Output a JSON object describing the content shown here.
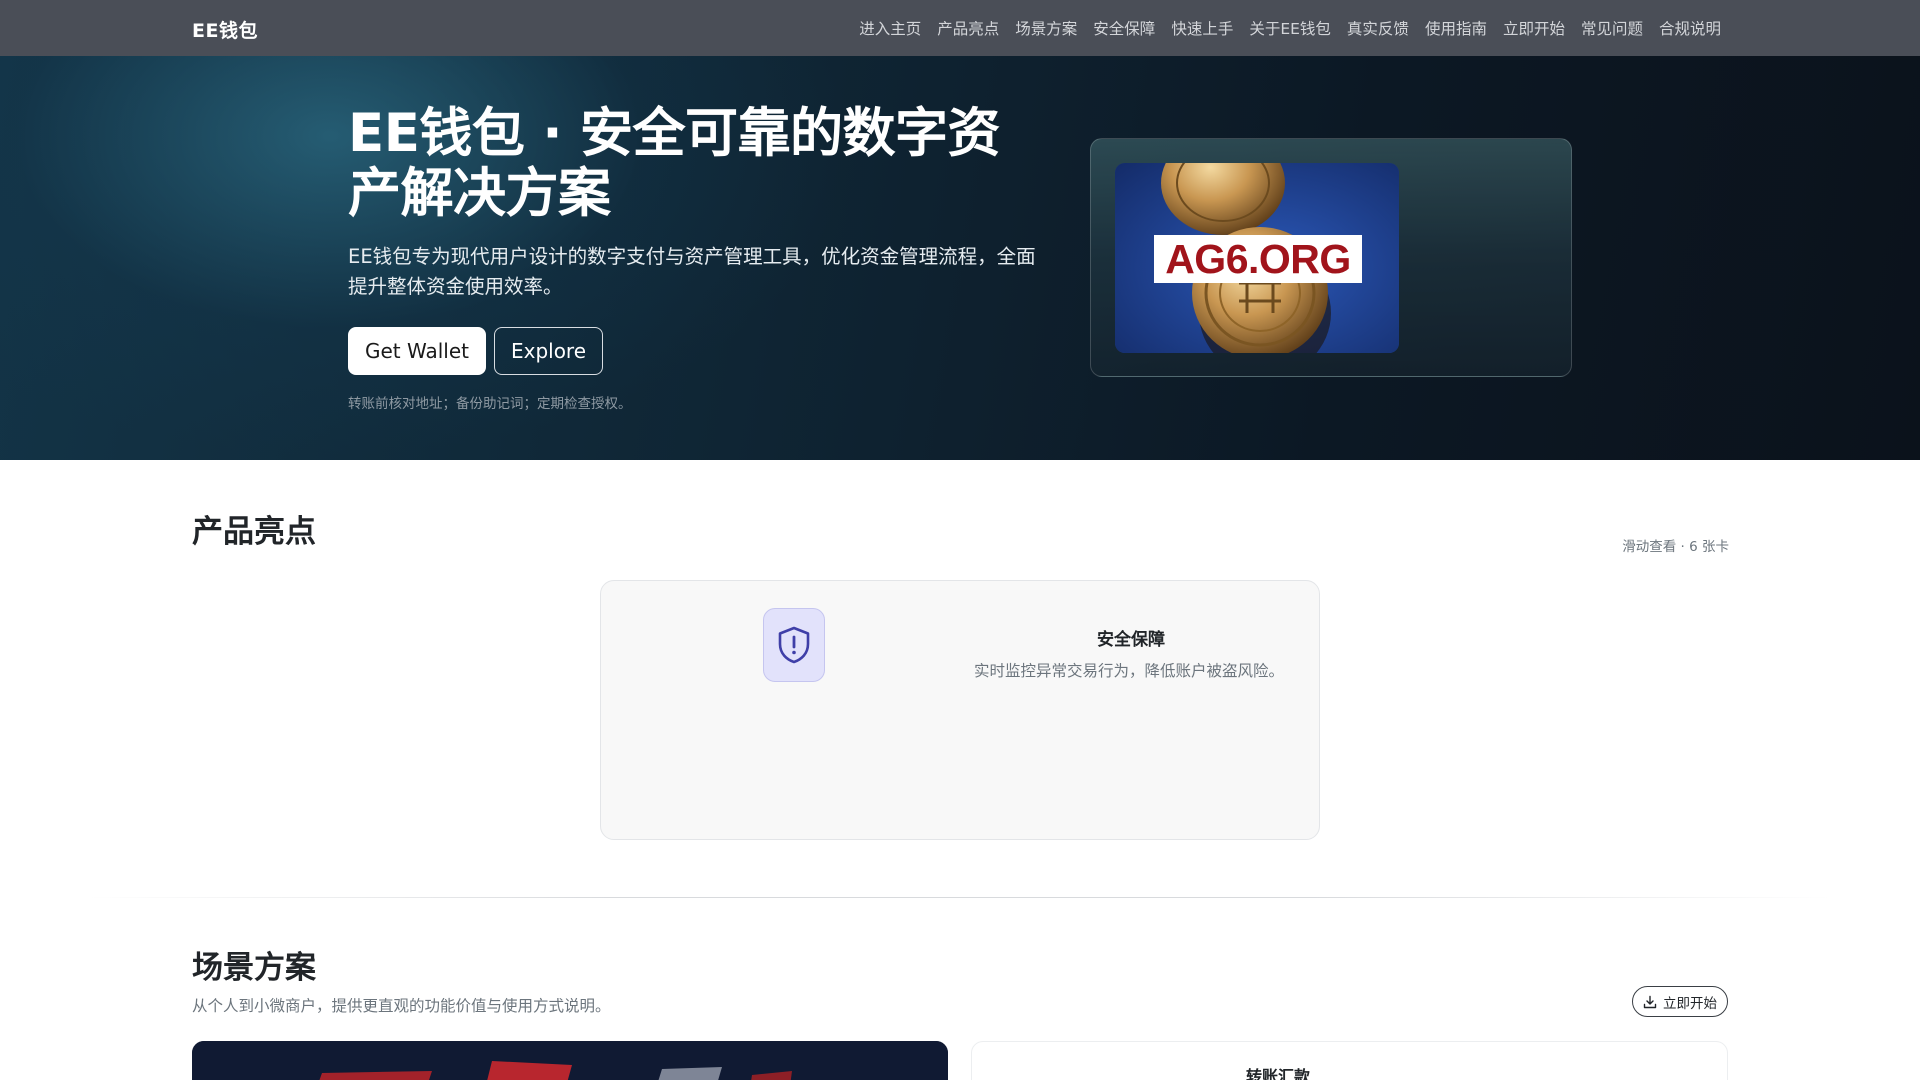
{
  "nav": {
    "brand": "EE钱包",
    "links": [
      "进入主页",
      "产品亮点",
      "场景方案",
      "安全保障",
      "快速上手",
      "关于EE钱包",
      "真实反馈",
      "使用指南",
      "立即开始",
      "常见问题",
      "合规说明"
    ]
  },
  "hero": {
    "title": "EE钱包 · 安全可靠的数字资产解决方案",
    "description": "EE钱包专为现代用户设计的数字支付与资产管理工具，优化资金管理流程，全面提升整体资金使用效率。",
    "primary_button": "Get Wallet",
    "secondary_button": "Explore",
    "note": "转账前核对地址；备份助记词；定期检查授权。",
    "image_label": "AG6.ORG"
  },
  "highlights": {
    "title": "产品亮点",
    "hint": "滑动查看 · 6 张卡",
    "card": {
      "icon": "shield-alert-icon",
      "title": "安全保障",
      "description": "实时监控异常交易行为，降低账户被盗风险。"
    }
  },
  "scenarios": {
    "title": "场景方案",
    "subtitle": "从个人到小微商户，提供更直观的功能价值与使用方式说明。",
    "start_button": "立即开始",
    "card_title": "转账汇款"
  },
  "colors": {
    "navbar": "#4a4e57",
    "hero_dark": "#0f2534",
    "accent_indigo": "#3f3fa8",
    "image_label_red": "#a1141b"
  }
}
